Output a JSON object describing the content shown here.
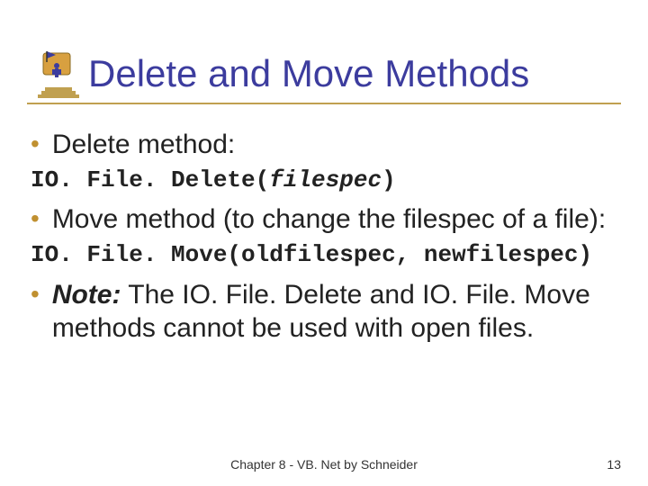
{
  "title": "Delete and Move Methods",
  "bullets": {
    "b1": "Delete method:",
    "code1_a": "IO. File. Delete(",
    "code1_b": "filespec",
    "code1_c": ")",
    "b2": "Move method (to change the filespec of a file):",
    "code2": "IO. File. Move(oldfilespec, newfilespec)",
    "b3_note": "Note:",
    "b3_rest": " The IO. File. Delete and IO. File. Move methods cannot be used with open files."
  },
  "footer": "Chapter 8 - VB. Net by Schneider",
  "page": "13"
}
